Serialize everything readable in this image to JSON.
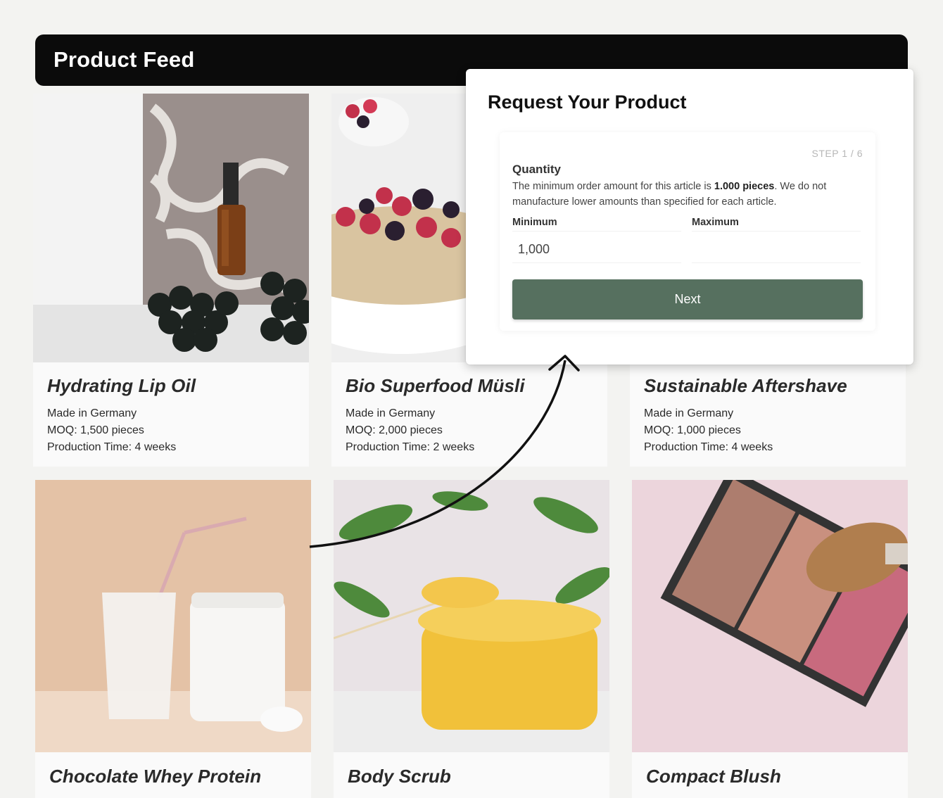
{
  "header": {
    "title": "Product Feed"
  },
  "products": [
    {
      "title": "Hydrating Lip Oil",
      "origin": "Made in Germany",
      "moq": "MOQ: 1,500 pieces",
      "production": "Production Time: 4 weeks"
    },
    {
      "title": "Bio Superfood Müsli",
      "origin": "Made in Germany",
      "moq": "MOQ: 2,000 pieces",
      "production": "Production Time: 2 weeks"
    },
    {
      "title": "Sustainable Aftershave",
      "origin": "Made in Germany",
      "moq": "MOQ: 1,000 pieces",
      "production": "Production Time: 4 weeks"
    },
    {
      "title": "Chocolate Whey Protein"
    },
    {
      "title": "Body Scrub"
    },
    {
      "title": "Compact Blush"
    }
  ],
  "modal": {
    "title": "Request Your Product",
    "step": "STEP 1 / 6",
    "quantity_label": "Quantity",
    "desc_prefix": "The minimum order amount for this article is ",
    "desc_bold": "1.000 pieces",
    "desc_suffix": ". We do not manufacture lower amounts than specified for each article.",
    "min_label": "Minimum",
    "max_label": "Maximum",
    "min_value": "1,000",
    "max_value": "",
    "next_label": "Next"
  },
  "colors": {
    "header_bg": "#0b0b0b",
    "button": "#56705f",
    "page_bg": "#f3f3f1"
  }
}
